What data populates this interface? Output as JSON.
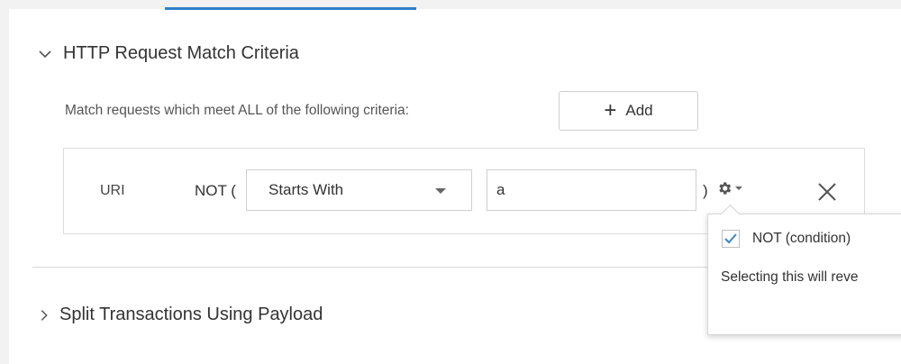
{
  "section_criteria": {
    "title": "HTTP Request Match Criteria",
    "description": "Match requests which meet ALL of the following criteria:",
    "add_button_label": "Add",
    "criterion": {
      "field_label": "URI",
      "not_open": "NOT (",
      "operator_selected": "Starts With",
      "value": "a",
      "close_paren": ")"
    }
  },
  "popover": {
    "checkbox_label": "NOT (condition)",
    "checkbox_checked": true,
    "description": "Selecting this will reve"
  },
  "section_split": {
    "title": "Split Transactions Using Payload"
  },
  "colors": {
    "accent": "#2f80c8",
    "check": "#3a86c8"
  }
}
